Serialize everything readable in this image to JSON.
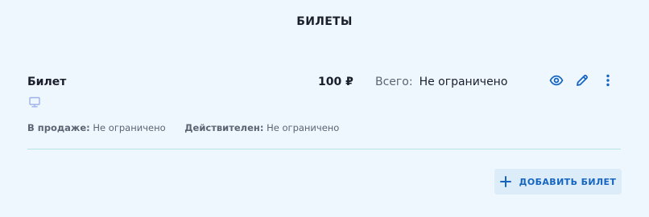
{
  "section": {
    "title": "БИЛЕТЫ"
  },
  "ticket": {
    "name": "Билет",
    "price": "100 ₽",
    "total_label": "Всего:",
    "total_value": "Не ограничено",
    "type_icon": "monitor-icon",
    "on_sale_label": "В продаже:",
    "on_sale_value": "Не ограничено",
    "valid_label": "Действителен:",
    "valid_value": "Не ограничено",
    "actions": {
      "view_icon": "eye-icon",
      "edit_icon": "pencil-icon",
      "more_icon": "kebab-menu-icon"
    }
  },
  "add_button": {
    "label": "ДОБАВИТЬ БИЛЕТ",
    "icon": "plus-icon"
  },
  "colors": {
    "background": "#eff7fe",
    "accent": "#1565c0",
    "divider": "#b7e3ea",
    "button_bg": "#dcedf9",
    "muted_icon": "#9fb0e8"
  }
}
